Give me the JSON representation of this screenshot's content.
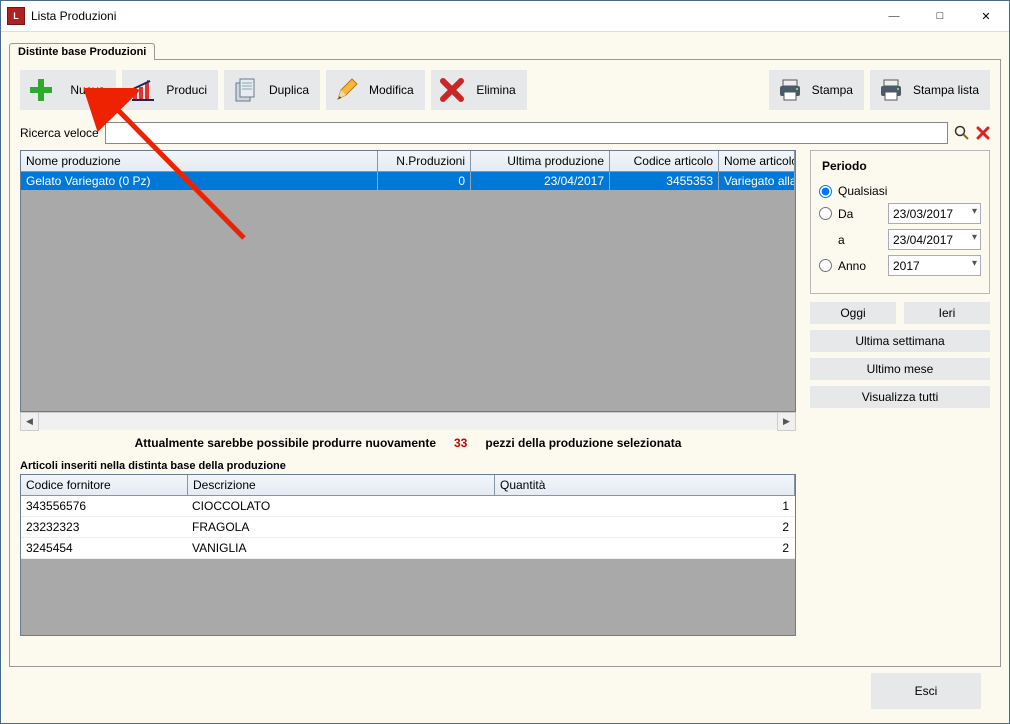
{
  "window": {
    "title": "Lista Produzioni"
  },
  "tab": {
    "label": "Distinte base Produzioni"
  },
  "toolbar": {
    "nuova": "Nuova",
    "produci": "Produci",
    "duplica": "Duplica",
    "modifica": "Modifica",
    "elimina": "Elimina",
    "stampa": "Stampa",
    "stampa_lista": "Stampa lista"
  },
  "search": {
    "label": "Ricerca veloce",
    "value": ""
  },
  "grid": {
    "headers": {
      "nome": "Nome produzione",
      "nprod": "N.Produzioni",
      "ultima": "Ultima produzione",
      "codart": "Codice articolo",
      "nomeart": "Nome articolo prodotto"
    },
    "rows": [
      {
        "nome": "Gelato Variegato (0 Pz)",
        "nprod": "0",
        "ultima": "23/04/2017",
        "codart": "3455353",
        "nomeart": "Variegato alla vaniglia"
      }
    ]
  },
  "msg": {
    "before": "Attualmente sarebbe possibile produrre nuovamente",
    "count": "33",
    "after": "pezzi della produzione selezionata"
  },
  "detail": {
    "title": "Articoli inseriti nella distinta base della produzione",
    "headers": {
      "cf": "Codice fornitore",
      "de": "Descrizione",
      "qt": "Quantità"
    },
    "rows": [
      {
        "cf": "343556576",
        "de": "CIOCCOLATO",
        "qt": "1"
      },
      {
        "cf": "23232323",
        "de": "FRAGOLA",
        "qt": "2"
      },
      {
        "cf": "3245454",
        "de": "VANIGLIA",
        "qt": "2"
      }
    ]
  },
  "period": {
    "title": "Periodo",
    "qualsiasi": "Qualsiasi",
    "da": "Da",
    "a": "a",
    "anno": "Anno",
    "date_from": "23/03/2017",
    "date_to": "23/04/2017",
    "year": "2017",
    "oggi": "Oggi",
    "ieri": "Ieri",
    "ultima_sett": "Ultima settimana",
    "ultimo_mese": "Ultimo mese",
    "visualizza": "Visualizza tutti"
  },
  "footer": {
    "esci": "Esci"
  }
}
